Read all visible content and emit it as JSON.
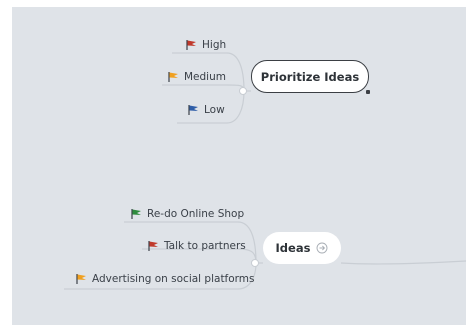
{
  "topics": {
    "prioritize": {
      "label": "Prioritize Ideas",
      "children": [
        {
          "label": "High",
          "flag": "red-flag-icon",
          "color": "#c0392b"
        },
        {
          "label": "Medium",
          "flag": "orange-flag-icon",
          "color": "#f0a020"
        },
        {
          "label": "Low",
          "flag": "blue-flag-icon",
          "color": "#2f5ea8"
        }
      ]
    },
    "ideas": {
      "label": "Ideas",
      "children": [
        {
          "label": "Re-do Online Shop",
          "flag": "green-flag-icon",
          "color": "#2e8b3e"
        },
        {
          "label": "Talk to partners",
          "flag": "red-flag-icon",
          "color": "#c0392b"
        },
        {
          "label": "Advertising on social platforms",
          "flag": "orange-flag-icon",
          "color": "#f0a020"
        }
      ]
    }
  },
  "colors": {
    "canvas": "#dfe3e8",
    "connector": "#c9ced4",
    "node_border": "#3b3f44"
  }
}
